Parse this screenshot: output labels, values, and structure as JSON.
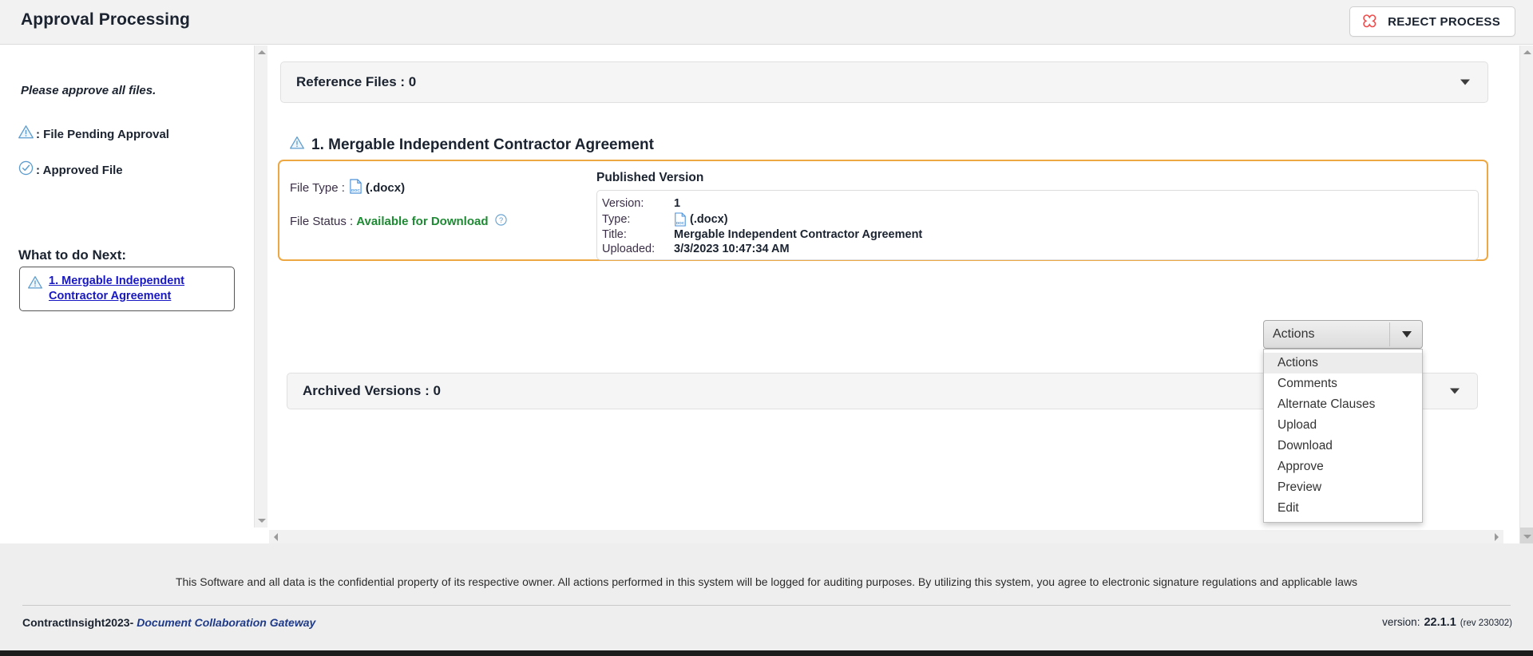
{
  "header": {
    "title": "Approval Processing",
    "reject_button": {
      "label": "REJECT PROCESS",
      "icon": "reject-x-icon",
      "icon_color": "#ef4b4b"
    }
  },
  "sidebar": {
    "note": "Please approve all files.",
    "legend": [
      {
        "icon": "warning-triangle-icon",
        "label": ": File Pending Approval"
      },
      {
        "icon": "check-circle-icon",
        "label": ": Approved File"
      }
    ],
    "what_next": {
      "title": "What to do Next:",
      "items": [
        {
          "icon": "warning-triangle-icon",
          "label": "1. Mergable Independent Contractor Agreement"
        }
      ]
    },
    "scrollbar": {
      "up": "scroll-up-arrow",
      "down": "scroll-down-arrow"
    }
  },
  "main": {
    "reference_files": {
      "title": "Reference Files : 0",
      "caret": "chevron-down-icon"
    },
    "document": {
      "heading": "1. Mergable Independent Contractor Agreement",
      "heading_icon": "warning-triangle-icon",
      "file_type_label": "File Type :",
      "file_type_value": "(.docx)",
      "file_type_icon": "doc-file-icon",
      "file_status_label": "File Status :",
      "file_status_value": "Available for Download",
      "file_status_help_icon": "help-circle-icon",
      "published": {
        "title": "Published Version",
        "rows": [
          {
            "key": "Version:",
            "value": "1"
          },
          {
            "key": "Type:",
            "value": "(.docx)",
            "icon": "doc-file-icon"
          },
          {
            "key": "Title:",
            "value": "Mergable Independent Contractor Agreement"
          },
          {
            "key": "Uploaded:",
            "value": "3/3/2023 10:47:34 AM"
          }
        ]
      },
      "actions": {
        "selected": "Actions",
        "caret": "chevron-down-icon",
        "options": [
          "Actions",
          "Comments",
          "Alternate Clauses",
          "Upload",
          "Download",
          "Approve",
          "Preview",
          "Edit"
        ]
      }
    },
    "archived_versions": {
      "title": "Archived Versions : 0",
      "caret": "chevron-down-icon"
    },
    "h_scrollbar": {
      "left": "scroll-left-arrow",
      "right": "scroll-right-arrow"
    },
    "v_scrollbar": {
      "up": "scroll-up-arrow",
      "down": "scroll-down-arrow"
    }
  },
  "footer": {
    "notice": "This Software and all data is the confidential property of its respective owner. All actions performed in this system will be logged for auditing purposes. By utilizing this system, you agree to electronic signature regulations and applicable laws",
    "brand_primary": "ContractInsight2023-",
    "brand_secondary": "Document Collaboration Gateway",
    "version_label": "version:",
    "version_number": "22.1.1",
    "version_rev": "(rev 230302)"
  },
  "colors": {
    "accent_orange": "#eda844",
    "link_blue": "#1717c4",
    "status_green": "#1e8a33",
    "reject_red": "#ef4b4b",
    "doc_icon_blue": "#4a90d9"
  }
}
